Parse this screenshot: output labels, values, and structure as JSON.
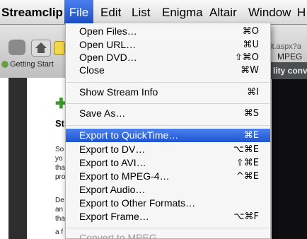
{
  "menubar": {
    "app": "Streamclip",
    "items": [
      "File",
      "Edit",
      "List",
      "Enigma",
      "Altair",
      "Window",
      "H"
    ]
  },
  "background": {
    "bookmark": "Getting Start",
    "url_fragment": "it.aspx?a",
    "mpeg_label": "MPEG",
    "banner_text": "lity conv",
    "heading": "Str",
    "body_lines": [
      "So",
      "yo",
      "tha",
      "pro",
      "De",
      "an",
      "tha",
      "a f"
    ]
  },
  "file_menu": {
    "items": [
      {
        "label": "Open Files…",
        "shortcut": "⌘O"
      },
      {
        "label": "Open URL…",
        "shortcut": "⌘U"
      },
      {
        "label": "Open DVD…",
        "shortcut": "⇧⌘O"
      },
      {
        "label": "Close",
        "shortcut": "⌘W"
      },
      {
        "label": "Show Stream Info",
        "shortcut": "⌘I"
      },
      {
        "label": "Save As…",
        "shortcut": "⌘S"
      },
      {
        "label": "Export to QuickTime…",
        "shortcut": "⌘E"
      },
      {
        "label": "Export to DV…",
        "shortcut": "⌥⌘E"
      },
      {
        "label": "Export to AVI…",
        "shortcut": "⇧⌘E"
      },
      {
        "label": "Export to MPEG-4…",
        "shortcut": "^⌘E"
      },
      {
        "label": "Export Audio…",
        "shortcut": ""
      },
      {
        "label": "Export to Other Formats…",
        "shortcut": ""
      },
      {
        "label": "Export Frame…",
        "shortcut": "⌥⌘F"
      },
      {
        "label": "Convert to MPEG…",
        "shortcut": ""
      }
    ]
  },
  "colors": {
    "highlight": "#2b5fd6",
    "menu_bg": "#f6f6f6"
  }
}
